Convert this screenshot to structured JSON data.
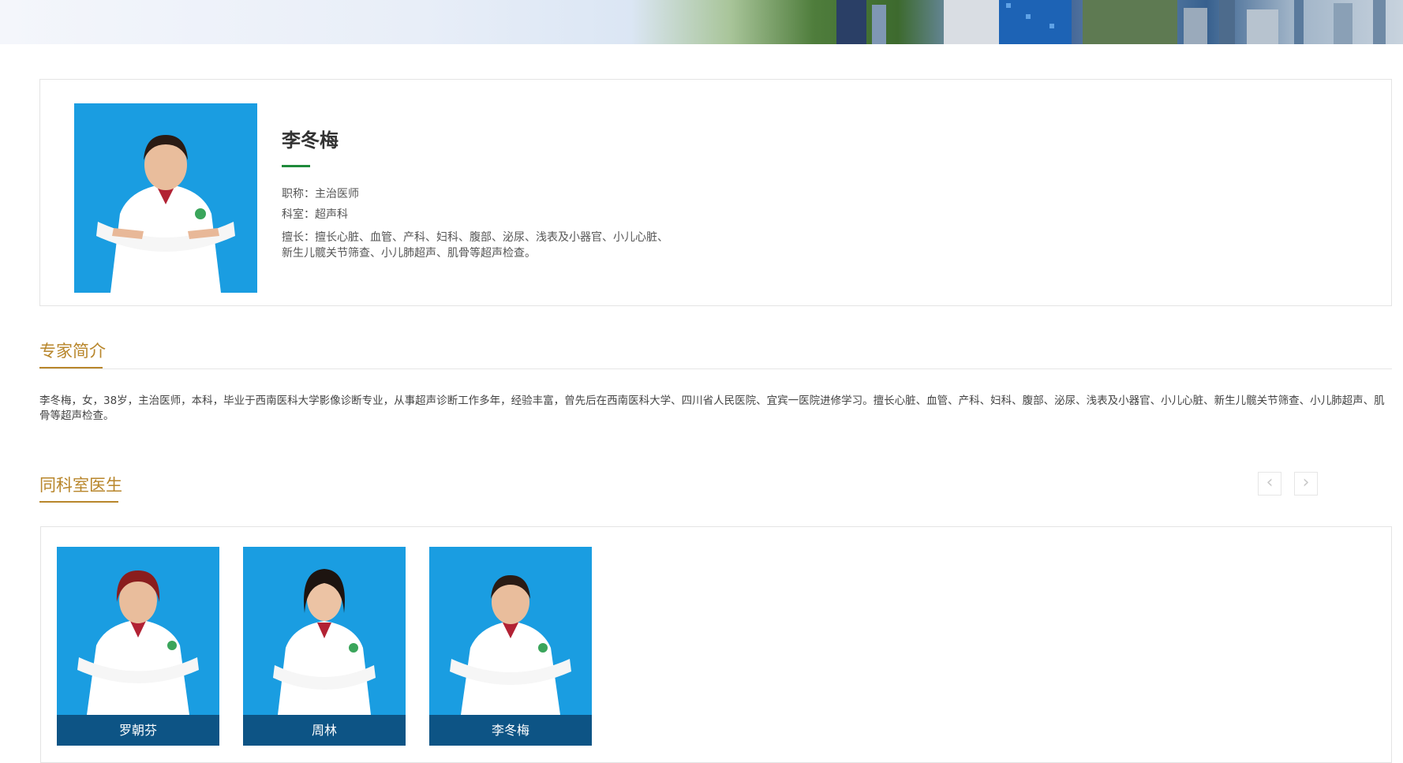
{
  "expert": {
    "name": "李冬梅",
    "title": "职称：主治医师",
    "department": "科室：超声科",
    "specialty": "擅长：擅长心脏、血管、产科、妇科、腹部、泌尿、浅表及小器官、小儿心脏、新生儿髋关节筛查、小儿肺超声、肌骨等超声检查。"
  },
  "intro": {
    "heading": "专家简介",
    "text": "李冬梅，女，38岁，主治医师，本科，毕业于西南医科大学影像诊断专业，从事超声诊断工作多年，经验丰富，曾先后在西南医科大学、四川省人民医院、宜宾一医院进修学习。擅长心脏、血管、产科、妇科、腹部、泌尿、浅表及小器官、小儿心脏、新生儿髋关节筛查、小儿肺超声、肌骨等超声检查。"
  },
  "colleagues": {
    "heading": "同科室医生",
    "prev_icon": "chevron-left-icon",
    "next_icon": "chevron-right-icon",
    "items": [
      {
        "name": "罗朝芬"
      },
      {
        "name": "周林"
      },
      {
        "name": "李冬梅"
      }
    ]
  },
  "colors": {
    "accent_gold": "#b8862b",
    "accent_green": "#1e8a3a",
    "photo_bg": "#1a9de1"
  }
}
